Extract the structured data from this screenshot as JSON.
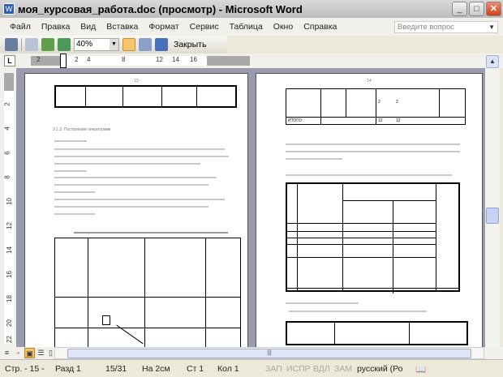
{
  "window": {
    "title": "моя_курсовая_работа.doc (просмотр) - Microsoft Word",
    "app_icon": "word-icon",
    "controls": [
      "minimize",
      "maximize",
      "close"
    ]
  },
  "menu": {
    "items": [
      "Файл",
      "Правка",
      "Вид",
      "Вставка",
      "Формат",
      "Сервис",
      "Таблица",
      "Окно",
      "Справка"
    ],
    "help_placeholder": "Введите вопрос"
  },
  "toolbar": {
    "zoom": "40%",
    "close_label": "Закрыть",
    "icons": [
      "print-icon",
      "magnifier-icon",
      "one-page-icon",
      "multiple-pages-icon",
      "view-ruler-icon",
      "shrink-to-fit-icon",
      "full-screen-icon"
    ]
  },
  "ruler": {
    "tab_selector": "L",
    "numbers": [
      "2",
      "2",
      "4",
      "8",
      "12",
      "14",
      "16"
    ]
  },
  "vruler": {
    "numbers": [
      "2",
      "4",
      "6",
      "8",
      "10",
      "12",
      "14",
      "16",
      "18",
      "20",
      "22"
    ]
  },
  "pages": [
    {
      "number": "- 13 -",
      "heading": "3.1.2. Построение оперограмм"
    },
    {
      "number": "- 14 -",
      "table_total_label": "ИТОГО:",
      "values": [
        "2",
        "2",
        "12",
        "12"
      ]
    }
  ],
  "status": {
    "page": "Стр. - 15 -",
    "section": "Разд 1",
    "pages": "15/31",
    "at": "На 2см",
    "line": "Ст 1",
    "col": "Кол 1",
    "rec": "ЗАП",
    "trk": "ИСПР",
    "ext": "ВДЛ",
    "ovr": "ЗАМ",
    "language": "русский (Ро"
  }
}
